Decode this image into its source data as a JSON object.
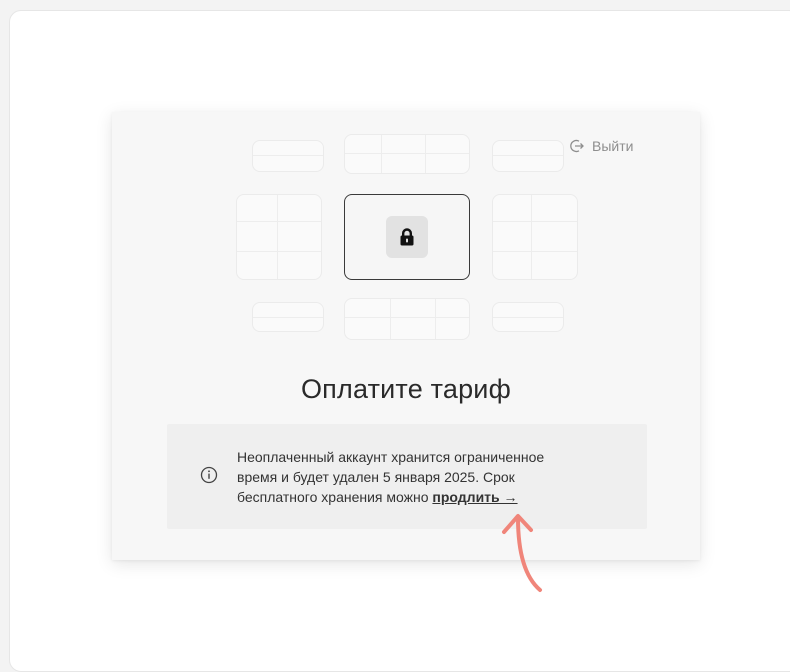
{
  "header": {
    "logout_label": "Выйти"
  },
  "title": "Оплатите тариф",
  "notice": {
    "line1": "Неоплаченный аккаунт хранится ограниченное",
    "line2": "время и будет удален 5 января 2025. Срок",
    "line3_prefix": "бесплатного хранения можно",
    "link_label": "продлить →"
  },
  "icons": {
    "logout": "logout-icon",
    "lock": "lock-icon",
    "info": "info-icon",
    "annotation": "arrow-annotation"
  },
  "colors": {
    "annotation_arrow": "#f0857a",
    "card_background": "#f7f7f7",
    "notice_background": "#efefef",
    "text": "#333333"
  }
}
